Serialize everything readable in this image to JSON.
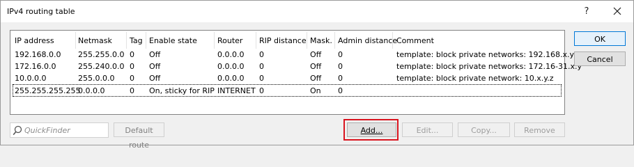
{
  "window": {
    "title": "IPv4 routing table",
    "help_glyph": "?"
  },
  "table": {
    "columns": [
      "IP address",
      "Netmask",
      "Tag",
      "Enable state",
      "Router",
      "RIP distance",
      "Mask.",
      "Admin distance",
      "Comment"
    ],
    "rows": [
      [
        "192.168.0.0",
        "255.255.0.0",
        "0",
        "Off",
        "0.0.0.0",
        "0",
        "Off",
        "0",
        "template: block private networks: 192.168.x.y"
      ],
      [
        "172.16.0.0",
        "255.240.0.0",
        "0",
        "Off",
        "0.0.0.0",
        "0",
        "Off",
        "0",
        "template: block private networks: 172.16-31.x.y"
      ],
      [
        "10.0.0.0",
        "255.0.0.0",
        "0",
        "Off",
        "0.0.0.0",
        "0",
        "Off",
        "0",
        "template: block private network: 10.x.y.z"
      ],
      [
        "255.255.255.255",
        "0.0.0.0",
        "0",
        "On, sticky for RIP",
        "INTERNET",
        "0",
        "On",
        "0",
        ""
      ]
    ]
  },
  "buttons": {
    "ok": "OK",
    "cancel": "Cancel",
    "default_route": "Default route",
    "add": "Add...",
    "edit": "Edit...",
    "copy": "Copy...",
    "remove": "Remove"
  },
  "quickfinder": {
    "placeholder": "QuickFinder"
  },
  "icons": {
    "close": "close-icon",
    "search": "search-icon"
  },
  "colors": {
    "highlight": "#d9141f",
    "ok_border": "#0078d7"
  }
}
